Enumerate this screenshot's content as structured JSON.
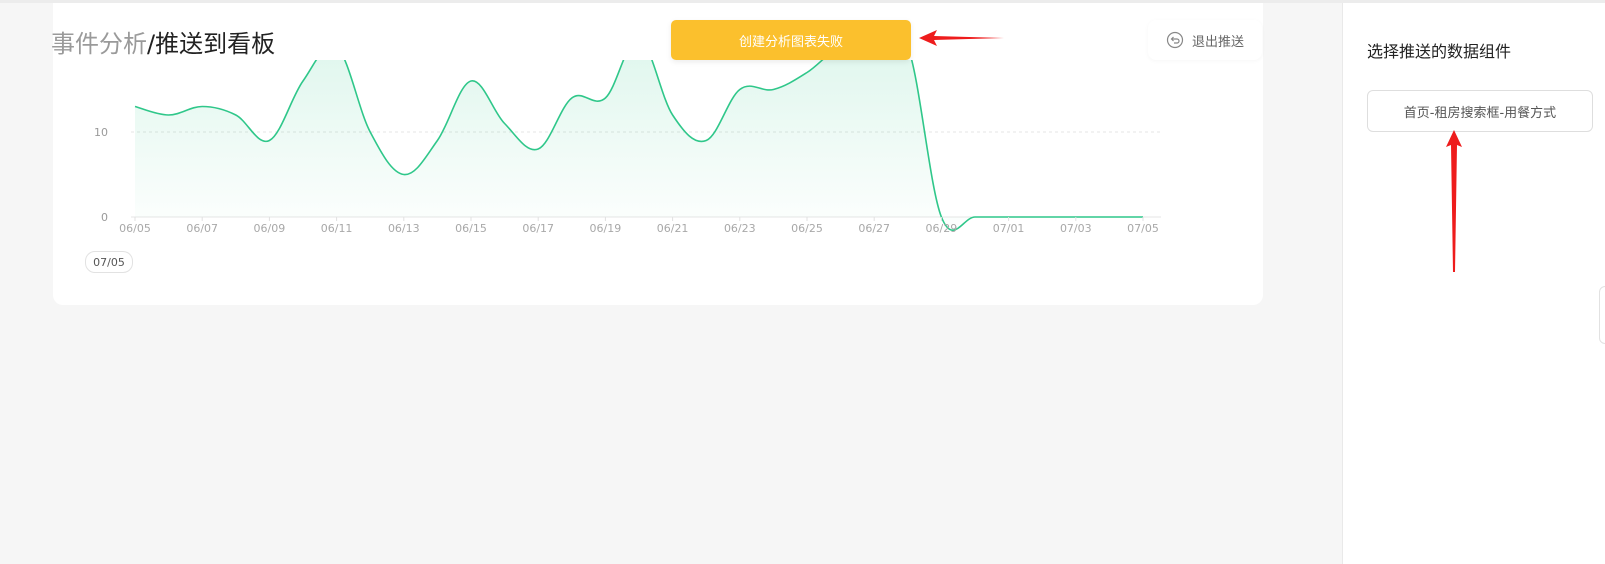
{
  "header": {
    "breadcrumb_parent": "事件分析",
    "separator": "/",
    "current": "推送到看板",
    "exit_button": "退出推送",
    "toast": "创建分析图表失败"
  },
  "chart_data": {
    "type": "area",
    "x": [
      "06/05",
      "06/06",
      "06/07",
      "06/08",
      "06/09",
      "06/10",
      "06/11",
      "06/12",
      "06/13",
      "06/14",
      "06/15",
      "06/16",
      "06/17",
      "06/18",
      "06/19",
      "06/20",
      "06/21",
      "06/22",
      "06/23",
      "06/24",
      "06/25",
      "06/26",
      "06/27",
      "06/28",
      "06/29",
      "06/30",
      "07/01",
      "07/02",
      "07/03",
      "07/04",
      "07/05"
    ],
    "x_ticks": [
      "06/05",
      "06/07",
      "06/09",
      "06/11",
      "06/13",
      "06/15",
      "06/17",
      "06/19",
      "06/21",
      "06/23",
      "06/25",
      "06/27",
      "06/29",
      "07/01",
      "07/03",
      "07/05"
    ],
    "values": [
      13,
      12,
      13,
      12,
      9,
      16,
      20,
      10,
      5,
      9,
      16,
      11,
      8,
      14,
      14,
      21,
      12,
      9,
      15,
      15,
      17,
      20,
      20,
      20,
      0,
      0,
      0,
      0,
      0,
      0,
      0
    ],
    "y_ticks": [
      0,
      10
    ],
    "ylim": [
      0,
      20
    ],
    "grid": true,
    "color": "#2fc78a"
  },
  "date_chip": "07/05",
  "sidebar": {
    "title": "选择推送的数据组件",
    "widget": "首页-租房搜索框-用餐方式"
  },
  "colors": {
    "toast_bg": "#fbc02d",
    "series": "#2fc78a",
    "annotation_arrow": "#ee1c1c"
  },
  "icons": {
    "exit": "undo-circle-icon"
  }
}
